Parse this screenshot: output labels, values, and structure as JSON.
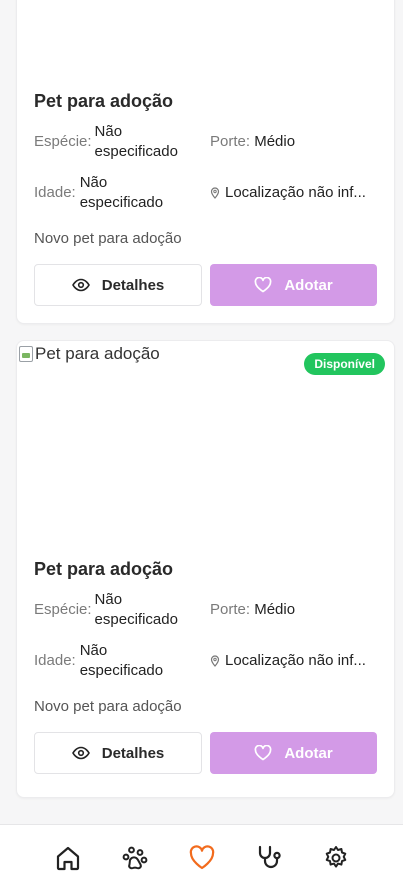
{
  "cards": [
    {
      "title": "Pet para adoção",
      "especie_label": "Espécie:",
      "especie_value": "Não especificado",
      "porte_label": "Porte:",
      "porte_value": "Médio",
      "idade_label": "Idade:",
      "idade_value": "Não especificado",
      "location": "Localização não inf...",
      "description": "Novo pet para adoção",
      "details_label": "Detalhes",
      "adopt_label": "Adotar"
    },
    {
      "image_alt": "Pet para adoção",
      "badge": "Disponível",
      "title": "Pet para adoção",
      "especie_label": "Espécie:",
      "especie_value": "Não especificado",
      "porte_label": "Porte:",
      "porte_value": "Médio",
      "idade_label": "Idade:",
      "idade_value": "Não especificado",
      "location": "Localização não inf...",
      "description": "Novo pet para adoção",
      "details_label": "Detalhes",
      "adopt_label": "Adotar"
    }
  ],
  "nav": {
    "items": [
      {
        "icon": "home-icon",
        "active": false
      },
      {
        "icon": "paw-icon",
        "active": false
      },
      {
        "icon": "heart-icon",
        "active": true
      },
      {
        "icon": "stethoscope-icon",
        "active": false
      },
      {
        "icon": "gear-icon",
        "active": false
      }
    ],
    "active_color": "#f26b1d",
    "inactive_color": "#222222"
  },
  "colors": {
    "adopt_button": "#d39ae7",
    "badge": "#22c55e"
  }
}
